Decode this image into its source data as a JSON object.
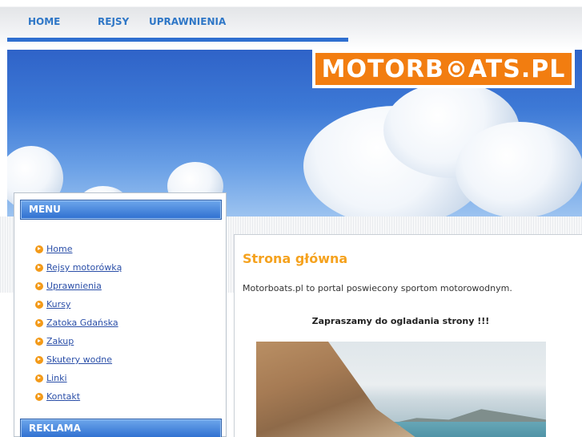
{
  "nav": {
    "items": [
      "HOME",
      "REJSY",
      "UPRAWNIENIA"
    ]
  },
  "header": {
    "logo_text_left": "MOTORB",
    "logo_text_right": "ATS.PL"
  },
  "sidebar": {
    "menu_title": "MENU",
    "items": [
      "Home",
      "Rejsy motorówką",
      "Uprawnienia",
      "Kursy",
      "Zatoka Gdańska",
      "Zakup",
      "Skutery wodne",
      "Linki",
      "Kontakt"
    ],
    "ad_title": "REKLAMA"
  },
  "main": {
    "title": "Strona główna",
    "intro": "Motorboats.pl to portal poswiecony sportom motorowodnym.",
    "invite": "Zapraszamy do ogladania strony !!!"
  },
  "colors": {
    "accent_blue": "#2f77c7",
    "logo_orange": "#f27d10",
    "title_orange": "#f5a21e"
  }
}
